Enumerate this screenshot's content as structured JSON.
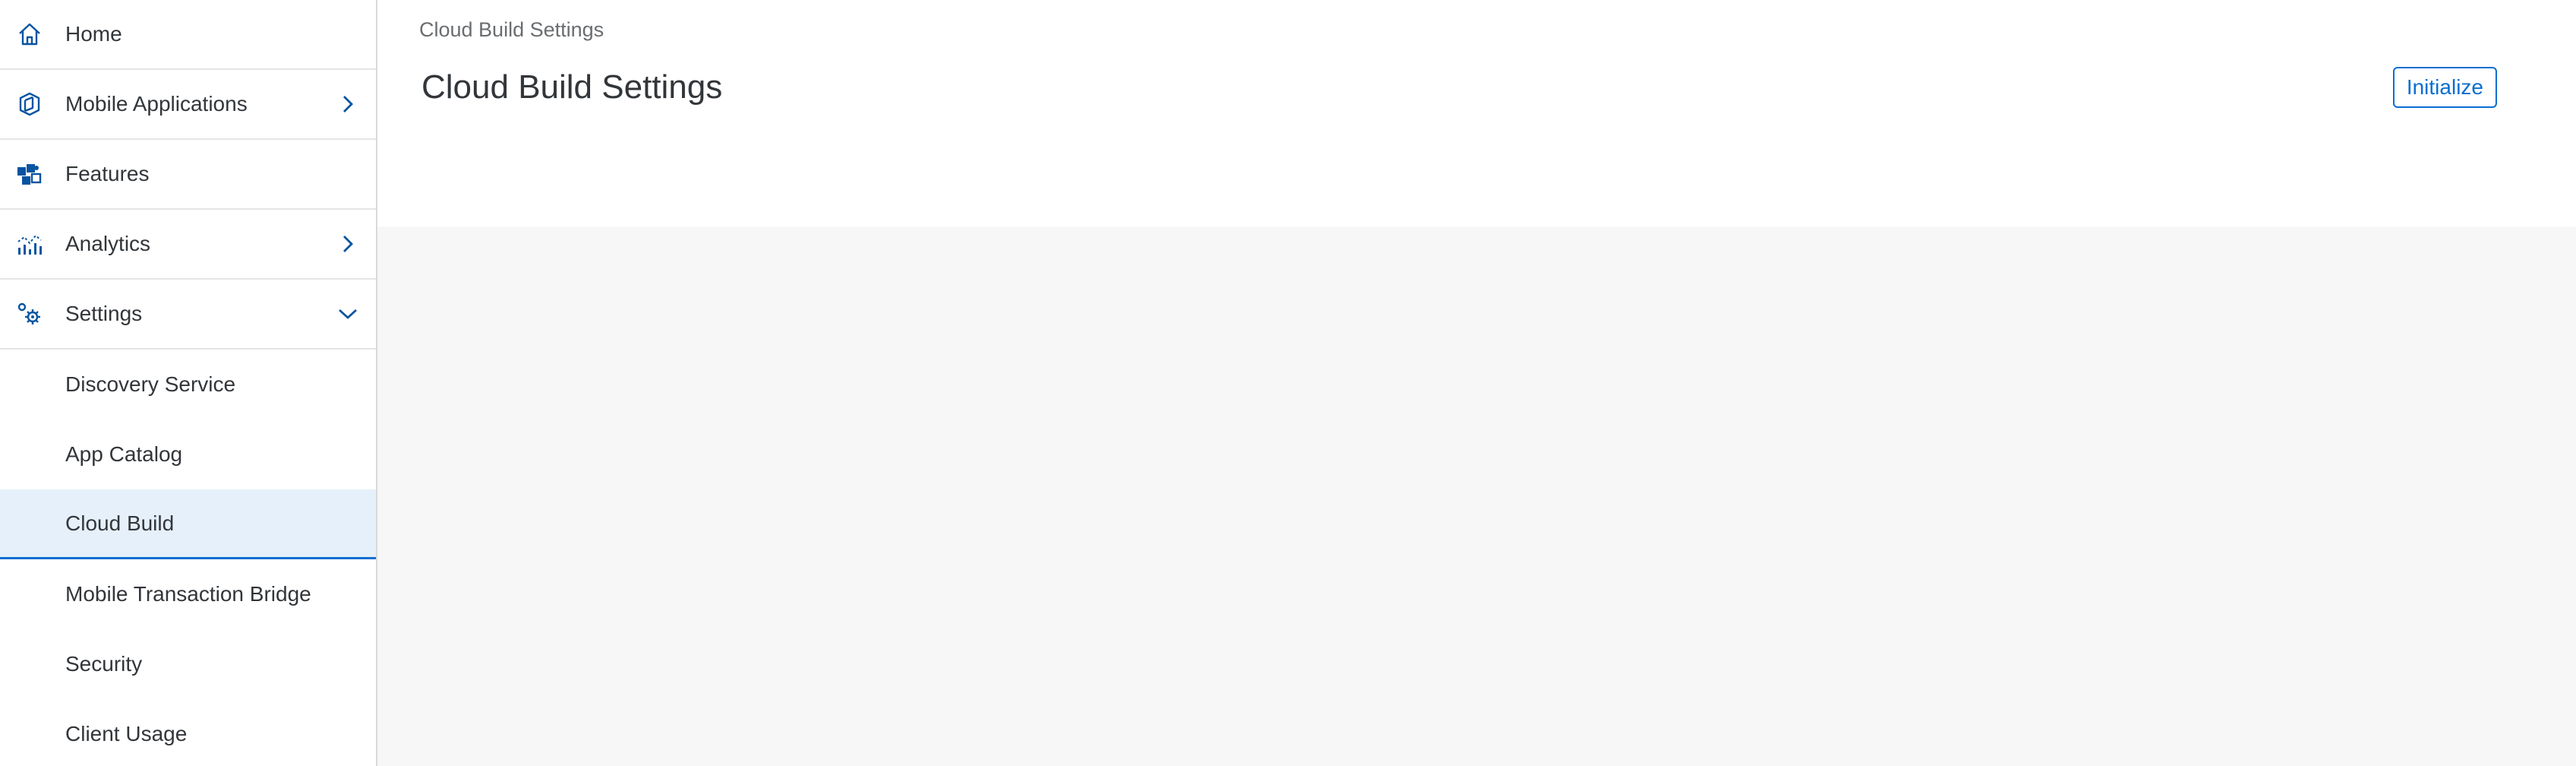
{
  "sidebar": {
    "items": [
      {
        "label": "Home",
        "icon": "home-icon"
      },
      {
        "label": "Mobile Applications",
        "icon": "mobile-apps-icon",
        "chevron": "chevron-right-icon"
      },
      {
        "label": "Features",
        "icon": "features-icon"
      },
      {
        "label": "Analytics",
        "icon": "analytics-icon",
        "chevron": "chevron-right-icon"
      },
      {
        "label": "Settings",
        "icon": "settings-icon",
        "chevron": "chevron-down-icon"
      }
    ],
    "settings_children": [
      {
        "label": "Discovery Service"
      },
      {
        "label": "App Catalog"
      },
      {
        "label": "Cloud Build",
        "selected": true
      },
      {
        "label": "Mobile Transaction Bridge"
      },
      {
        "label": "Security"
      },
      {
        "label": "Client Usage"
      }
    ]
  },
  "main": {
    "breadcrumb": "Cloud Build Settings",
    "title": "Cloud Build Settings",
    "initialize_label": "Initialize"
  },
  "colors": {
    "accent": "#0a6ed1",
    "icon_blue": "#0854a0",
    "selected_bg": "#e5f0fa",
    "content_bg": "#f7f7f7",
    "text": "#32363a",
    "muted_text": "#6a6d70"
  }
}
